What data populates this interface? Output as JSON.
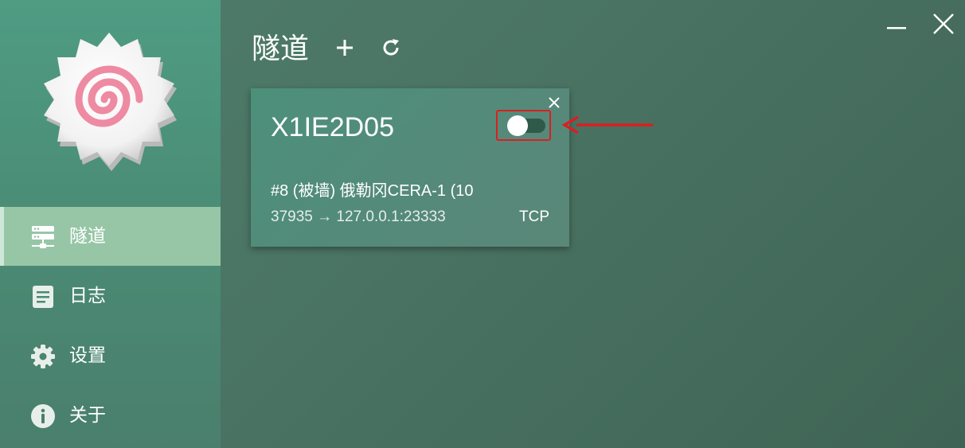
{
  "window": {
    "minimize_icon": "minimize-icon",
    "close_icon": "close-icon"
  },
  "sidebar": {
    "logo": "narutomaki-logo",
    "items": [
      {
        "label": "隧道",
        "icon": "server-icon",
        "active": true
      },
      {
        "label": "日志",
        "icon": "log-document-icon",
        "active": false
      },
      {
        "label": "设置",
        "icon": "gear-icon",
        "active": false
      },
      {
        "label": "关于",
        "icon": "info-icon",
        "active": false
      }
    ]
  },
  "main": {
    "title": "隧道",
    "add_icon": "plus-icon",
    "refresh_icon": "refresh-icon"
  },
  "tunnel_card": {
    "name": "X1IE2D05",
    "server": "#8 (被墙) 俄勒冈CERA-1 (10",
    "mapping": "37935 → 127.0.0.1:23333",
    "protocol": "TCP",
    "enabled": false
  },
  "colors": {
    "annotation_red": "#d9201f",
    "active_nav": "#97c6a7",
    "toggle_track": "#2f5a49"
  }
}
